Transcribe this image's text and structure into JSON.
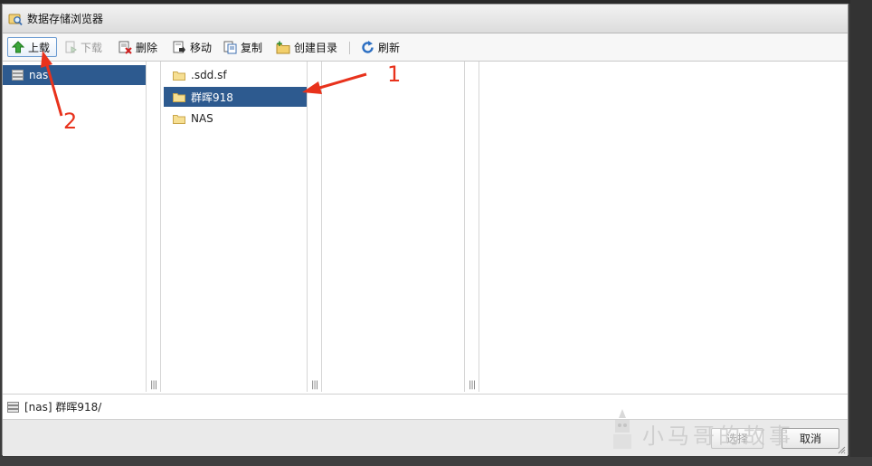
{
  "window": {
    "title": "数据存储浏览器"
  },
  "toolbar": {
    "upload": "上载",
    "download": "下载",
    "delete": "删除",
    "move": "移动",
    "copy": "复制",
    "create_dir": "创建目录",
    "refresh": "刷新"
  },
  "datastores": [
    {
      "label": "nas",
      "selected": true
    }
  ],
  "folders": [
    {
      "label": ".sdd.sf",
      "selected": false
    },
    {
      "label": "群晖918",
      "selected": true
    },
    {
      "label": "NAS",
      "selected": false
    }
  ],
  "status": {
    "path": "[nas] 群晖918/"
  },
  "footer": {
    "select": "选择",
    "cancel": "取消"
  },
  "watermark": "小马哥的故事",
  "annotations": {
    "one": "1",
    "two": "2"
  },
  "colors": {
    "selection": "#2d5a8f",
    "annotation": "#e8321c"
  }
}
